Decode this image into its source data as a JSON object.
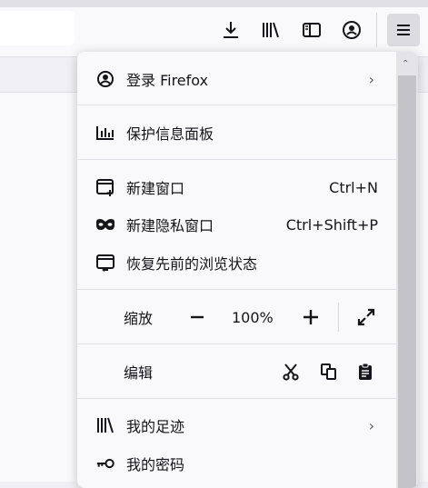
{
  "toolbar": {
    "icons": [
      "download-icon",
      "library-icon",
      "sidebar-icon",
      "account-icon",
      "hamburger-menu-icon"
    ]
  },
  "menu": {
    "signin_label": "登录 Firefox",
    "protections_label": "保护信息面板",
    "new_window_label": "新建窗口",
    "new_window_shortcut": "Ctrl+N",
    "private_window_label": "新建隐私窗口",
    "private_window_shortcut": "Ctrl+Shift+P",
    "restore_session_label": "恢复先前的浏览状态",
    "zoom_label": "缩放",
    "zoom_value": "100%",
    "edit_label": "编辑",
    "history_label": "我的足迹",
    "passwords_label": "我的密码"
  },
  "colors": {
    "panel_bg": "#f9f9fb",
    "text": "#15141a",
    "separator": "#e0e0e6"
  }
}
